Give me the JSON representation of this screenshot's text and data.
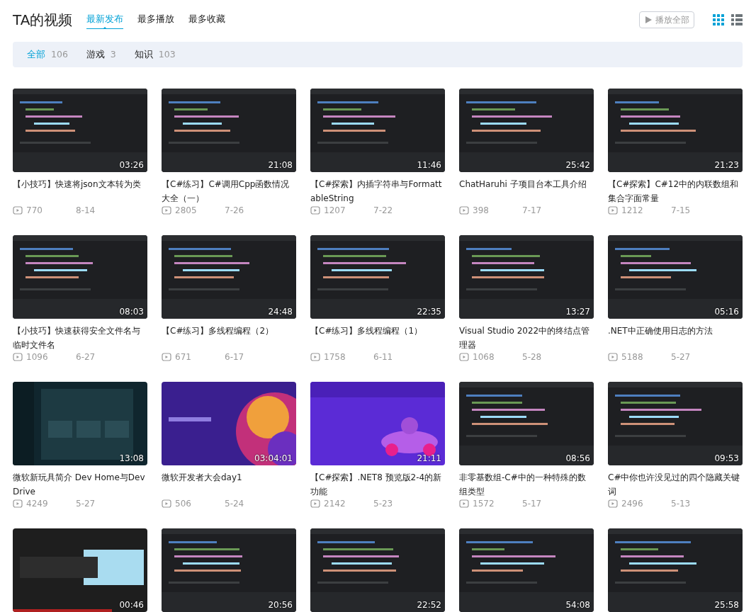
{
  "header": {
    "title": "TA的视频",
    "tabs": [
      {
        "label": "最新发布",
        "selected": true
      },
      {
        "label": "最多播放",
        "selected": false
      },
      {
        "label": "最多收藏",
        "selected": false
      }
    ],
    "play_all": "播放全部",
    "views": [
      {
        "kind": "grid",
        "selected": true
      },
      {
        "kind": "list",
        "selected": false
      }
    ]
  },
  "filters": [
    {
      "label": "全部",
      "count": "106",
      "selected": true
    },
    {
      "label": "游戏",
      "count": "3",
      "selected": false
    },
    {
      "label": "知识",
      "count": "103",
      "selected": false
    }
  ],
  "videos": [
    {
      "duration": "03:26",
      "title": "【小技巧】快速将json文本转为类",
      "plays": "770",
      "date": "8-14"
    },
    {
      "duration": "21:08",
      "title": "【C#练习】C#调用Cpp函数情况大全（一）",
      "plays": "2805",
      "date": "7-26"
    },
    {
      "duration": "11:46",
      "title": "【C#探索】内插字符串与FormattableString",
      "plays": "1207",
      "date": "7-22"
    },
    {
      "duration": "25:42",
      "title": "ChatHaruhi 子项目台本工具介绍",
      "plays": "398",
      "date": "7-17"
    },
    {
      "duration": "21:23",
      "title": "【C#探索】C#12中的内联数组和集合字面常量",
      "plays": "1212",
      "date": "7-15"
    },
    {
      "duration": "08:03",
      "title": "【小技巧】快速获得安全文件名与临时文件名",
      "plays": "1096",
      "date": "6-27"
    },
    {
      "duration": "24:48",
      "title": "【C#练习】多线程编程（2）",
      "plays": "671",
      "date": "6-17"
    },
    {
      "duration": "22:35",
      "title": "【C#练习】多线程编程（1）",
      "plays": "1758",
      "date": "6-11"
    },
    {
      "duration": "13:27",
      "title": "Visual Studio 2022中的终结点管理器",
      "plays": "1068",
      "date": "5-28"
    },
    {
      "duration": "05:16",
      "title": ".NET中正确使用日志的方法",
      "plays": "5188",
      "date": "5-27"
    },
    {
      "duration": "13:08",
      "title": "微软新玩具简介 Dev Home与Dev Drive",
      "plays": "4249",
      "date": "5-27"
    },
    {
      "duration": "03:04:01",
      "title": "微软开发者大会day1",
      "plays": "506",
      "date": "5-24"
    },
    {
      "duration": "21:11",
      "title": "【C#探索】.NET8 预览版2-4的新功能",
      "plays": "2142",
      "date": "5-23"
    },
    {
      "duration": "08:56",
      "title": "非零基数组-C#中的一种特殊的数组类型",
      "plays": "1572",
      "date": "5-17"
    },
    {
      "duration": "09:53",
      "title": "C#中你也许没见过的四个隐藏关键词",
      "plays": "2496",
      "date": "5-13"
    },
    {
      "duration": "00:46"
    },
    {
      "duration": "20:56"
    },
    {
      "duration": "22:52"
    },
    {
      "duration": "54:08"
    },
    {
      "duration": "25:58"
    }
  ]
}
